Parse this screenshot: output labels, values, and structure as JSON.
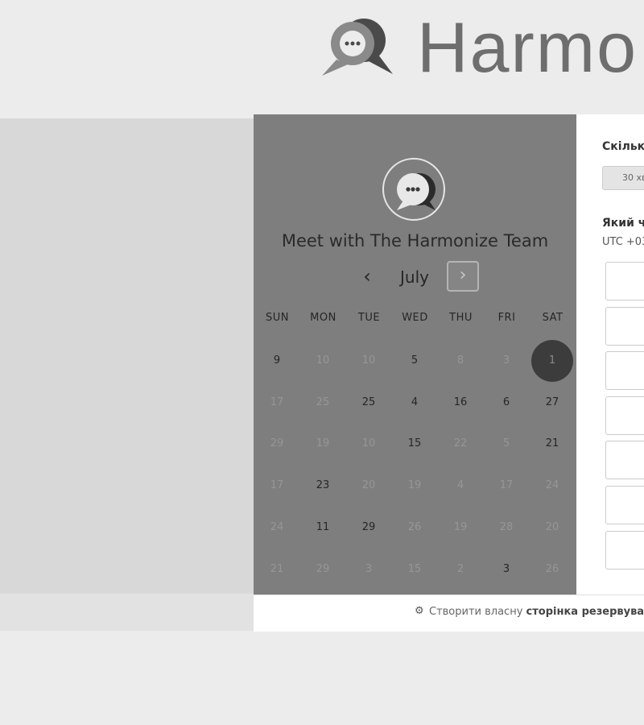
{
  "header": {
    "brand_name": "Harmo"
  },
  "calendar": {
    "title": "Meet with The Harmonize Team",
    "month": "July",
    "prev_symbol": "‹",
    "next_symbol": "›",
    "weekdays": [
      "SUN",
      "MON",
      "TUE",
      "WED",
      "THU",
      "FRI",
      "SAT"
    ],
    "weeks": [
      [
        {
          "d": "9",
          "s": "active"
        },
        {
          "d": "10",
          "s": "dim"
        },
        {
          "d": "10",
          "s": "dim"
        },
        {
          "d": "5",
          "s": "active"
        },
        {
          "d": "8",
          "s": "dim"
        },
        {
          "d": "3",
          "s": "dim"
        },
        {
          "d": "1",
          "s": "selected"
        }
      ],
      [
        {
          "d": "17",
          "s": "dim"
        },
        {
          "d": "25",
          "s": "dim"
        },
        {
          "d": "25",
          "s": "active"
        },
        {
          "d": "4",
          "s": "active"
        },
        {
          "d": "16",
          "s": "active"
        },
        {
          "d": "6",
          "s": "active"
        },
        {
          "d": "27",
          "s": "active"
        }
      ],
      [
        {
          "d": "29",
          "s": "dim"
        },
        {
          "d": "19",
          "s": "dim"
        },
        {
          "d": "10",
          "s": "dim"
        },
        {
          "d": "15",
          "s": "active"
        },
        {
          "d": "22",
          "s": "dim"
        },
        {
          "d": "5",
          "s": "dim"
        },
        {
          "d": "21",
          "s": "active"
        }
      ],
      [
        {
          "d": "17",
          "s": "dim"
        },
        {
          "d": "23",
          "s": "active"
        },
        {
          "d": "20",
          "s": "dim"
        },
        {
          "d": "19",
          "s": "dim"
        },
        {
          "d": "4",
          "s": "dim"
        },
        {
          "d": "17",
          "s": "dim"
        },
        {
          "d": "24",
          "s": "dim"
        }
      ],
      [
        {
          "d": "24",
          "s": "dim"
        },
        {
          "d": "11",
          "s": "active"
        },
        {
          "d": "29",
          "s": "active"
        },
        {
          "d": "26",
          "s": "dim"
        },
        {
          "d": "19",
          "s": "dim"
        },
        {
          "d": "28",
          "s": "dim"
        },
        {
          "d": "20",
          "s": "dim"
        }
      ],
      [
        {
          "d": "21",
          "s": "dim"
        },
        {
          "d": "29",
          "s": "dim"
        },
        {
          "d": "3",
          "s": "dim"
        },
        {
          "d": "15",
          "s": "dim"
        },
        {
          "d": "2",
          "s": "dim"
        },
        {
          "d": "3",
          "s": "active"
        },
        {
          "d": "26",
          "s": "dim"
        }
      ]
    ]
  },
  "booking": {
    "duration_question": "Скільк",
    "duration_option": "30 хв",
    "time_question": "Який ч",
    "timezone": "UTC +03",
    "slot_count": 7
  },
  "footer": {
    "icon": "hubspot-sprocket-icon",
    "text_prefix": "Створити власну",
    "text_bold": "сторінка резервува"
  },
  "colors": {
    "calendar_bg": "#7e7e7e",
    "selected_day": "#3c3c3c",
    "page_bg": "#ececec"
  }
}
